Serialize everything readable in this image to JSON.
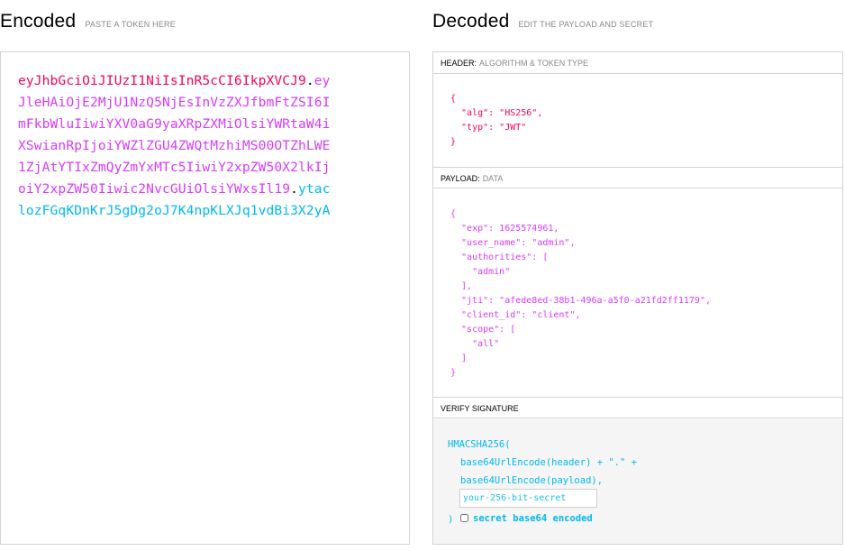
{
  "encoded": {
    "title": "Encoded",
    "subtitle": "PASTE A TOKEN HERE",
    "token_lines": [
      [
        {
          "part": "header",
          "text": "eyJhbGciOiJIUzI1NiIsInR5cCI6IkpXVCJ9"
        },
        {
          "part": "dot",
          "text": "."
        },
        {
          "part": "payload",
          "text": "ey"
        }
      ],
      [
        {
          "part": "payload",
          "text": "JleHAiOjE2MjU1NzQ5NjEsInVzZXJfbmFtZSI6I"
        }
      ],
      [
        {
          "part": "payload",
          "text": "mFkbWluIiwiYXV0aG9yaXRpZXMiOlsiYWRtaW4i"
        }
      ],
      [
        {
          "part": "payload",
          "text": "XSwianRpIjoiYWZlZGU4ZWQtMzhiMS00OTZhLWE"
        }
      ],
      [
        {
          "part": "payload",
          "text": "1ZjAtYTIxZmQyZmYxMTc5IiwiY2xpZW50X2lkIj"
        }
      ],
      [
        {
          "part": "payload",
          "text": "oiY2xpZW50Iiwic2NvcGUiOlsiYWxsIl19"
        },
        {
          "part": "dot",
          "text": "."
        },
        {
          "part": "sig",
          "text": "ytac"
        }
      ],
      [
        {
          "part": "sig",
          "text": "lozFGqKDnKrJ5gDg2oJ7K4npKLXJq1vdBi3X2yA"
        }
      ]
    ]
  },
  "decoded": {
    "title": "Decoded",
    "subtitle": "EDIT THE PAYLOAD AND SECRET",
    "header_section": {
      "label": "HEADER:",
      "sublabel": "ALGORITHM & TOKEN TYPE",
      "json_lines": [
        "{",
        "  \"alg\": \"HS256\",",
        "  \"typ\": \"JWT\"",
        "}"
      ]
    },
    "payload_section": {
      "label": "PAYLOAD:",
      "sublabel": "DATA",
      "json_lines": [
        "{",
        "  \"exp\": 1625574961,",
        "  \"user_name\": \"admin\",",
        "  \"authorities\": [",
        "    \"admin\"",
        "  ],",
        "  \"jti\": \"afede8ed-38b1-496a-a5f0-a21fd2ff1179\",",
        "  \"client_id\": \"client\",",
        "  \"scope\": [",
        "    \"all\"",
        "  ]",
        "}"
      ]
    },
    "verify_section": {
      "label": "VERIFY SIGNATURE",
      "function": "HMACSHA256(",
      "line1": "base64UrlEncode(header) + \".\" +",
      "line2": "base64UrlEncode(payload),",
      "secret_placeholder": "your-256-bit-secret",
      "secret_value": "",
      "closing": ")",
      "base64_label": "secret base64 encoded",
      "base64_checked": false
    }
  },
  "colors": {
    "header": "#fb015b",
    "payload": "#d63aff",
    "signature": "#00b9f1"
  }
}
